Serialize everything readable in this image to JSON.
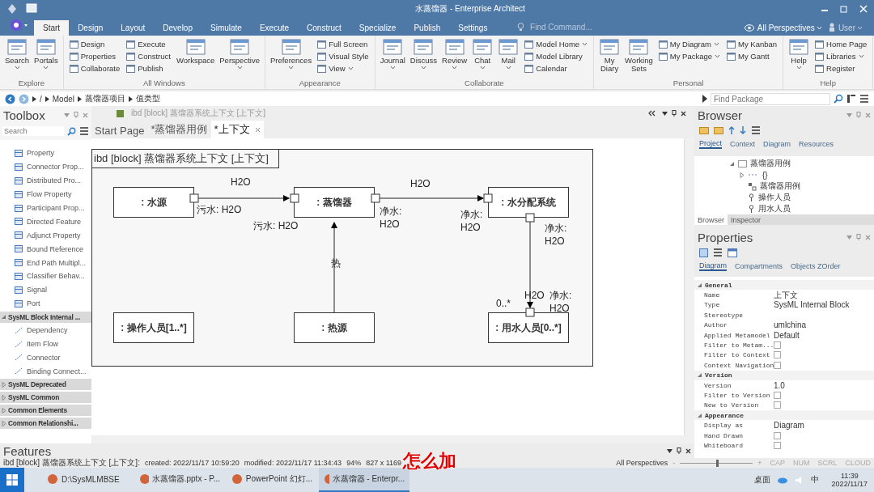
{
  "window": {
    "title": "水蒸馏器 - Enterprise Architect"
  },
  "ribbon_tabs": [
    {
      "label": "Start",
      "selected": true
    },
    {
      "label": "Design",
      "selected": false
    },
    {
      "label": "Layout",
      "selected": false
    },
    {
      "label": "Develop",
      "selected": false
    },
    {
      "label": "Simulate",
      "selected": false
    },
    {
      "label": "Execute",
      "selected": false
    },
    {
      "label": "Construct",
      "selected": false
    },
    {
      "label": "Specialize",
      "selected": false
    },
    {
      "label": "Publish",
      "selected": false
    },
    {
      "label": "Settings",
      "selected": false
    }
  ],
  "find_command": {
    "placeholder": "Find Command..."
  },
  "perspective": "All Perspectives",
  "user": "User",
  "ribbon_groups": [
    {
      "label": "Explore",
      "blocks": [
        {
          "kind": "large",
          "items": [
            {
              "label": "Search",
              "menu": true
            }
          ]
        },
        {
          "kind": "large",
          "items": [
            {
              "label": "Portals",
              "menu": true
            }
          ]
        }
      ]
    },
    {
      "label": "All Windows",
      "blocks": [
        {
          "kind": "column",
          "items": [
            {
              "label": "Design",
              "menu": false
            },
            {
              "label": "Properties",
              "menu": false
            },
            {
              "label": "Collaborate",
              "menu": false
            }
          ]
        },
        {
          "kind": "column",
          "items": [
            {
              "label": "Execute",
              "menu": false
            },
            {
              "label": "Construct",
              "menu": false
            },
            {
              "label": "Publish",
              "menu": false
            }
          ]
        },
        {
          "kind": "large",
          "items": [
            {
              "label": "Workspace",
              "menu": false
            }
          ]
        },
        {
          "kind": "large",
          "items": [
            {
              "label": "Perspective",
              "menu": true
            }
          ]
        }
      ]
    },
    {
      "label": "Appearance",
      "blocks": [
        {
          "kind": "large",
          "items": [
            {
              "label": "Preferences",
              "menu": true
            }
          ]
        },
        {
          "kind": "column",
          "items": [
            {
              "label": "Full Screen",
              "menu": false
            },
            {
              "label": "Visual Style",
              "menu": false
            },
            {
              "label": "View",
              "menu": true
            }
          ]
        }
      ]
    },
    {
      "label": "Collaborate",
      "blocks": [
        {
          "kind": "large",
          "items": [
            {
              "label": "Journal",
              "menu": true
            }
          ]
        },
        {
          "kind": "large",
          "items": [
            {
              "label": "Discuss",
              "menu": true
            }
          ]
        },
        {
          "kind": "large",
          "items": [
            {
              "label": "Review",
              "menu": true
            }
          ]
        },
        {
          "kind": "large",
          "items": [
            {
              "label": "Chat",
              "menu": true
            }
          ]
        },
        {
          "kind": "large",
          "items": [
            {
              "label": "Mail",
              "menu": true
            }
          ]
        },
        {
          "kind": "column",
          "items": [
            {
              "label": "Model Home",
              "menu": true
            },
            {
              "label": "Model Library",
              "menu": false
            },
            {
              "label": "Calendar",
              "menu": false
            }
          ]
        }
      ]
    },
    {
      "label": "Personal",
      "blocks": [
        {
          "kind": "large",
          "items": [
            {
              "label": "My Diary",
              "menu": false
            }
          ]
        },
        {
          "kind": "large",
          "items": [
            {
              "label": "Working Sets",
              "menu": false
            }
          ]
        },
        {
          "kind": "column",
          "items": [
            {
              "label": "My Diagram",
              "menu": true
            },
            {
              "label": "My Package",
              "menu": true
            }
          ]
        },
        {
          "kind": "column",
          "items": [
            {
              "label": "My Kanban",
              "menu": false
            },
            {
              "label": "My Gantt",
              "menu": false
            }
          ]
        }
      ]
    },
    {
      "label": "Help",
      "blocks": [
        {
          "kind": "large",
          "items": [
            {
              "label": "Help",
              "menu": true
            }
          ]
        },
        {
          "kind": "column",
          "items": [
            {
              "label": "Home Page",
              "menu": false
            },
            {
              "label": "Libraries",
              "menu": true
            },
            {
              "label": "Register",
              "menu": false
            }
          ]
        }
      ]
    }
  ],
  "breadcrumb": [
    "/",
    "Model",
    "蒸馏器项目",
    "值类型"
  ],
  "find_package": {
    "placeholder": "Find Package"
  },
  "toolbox": {
    "title": "Toolbox",
    "search": {
      "placeholder": "Search"
    },
    "items": [
      "Property",
      "Connector Prop...",
      "Distributed Pro...",
      "Flow Property",
      "Participant Prop...",
      "Directed Feature",
      "Adjunct Property",
      "Bound Reference",
      "End Path Multipl...",
      "Classifier Behav...",
      "Signal",
      "Port"
    ],
    "sections": [
      {
        "title": "SysML Block Internal ...",
        "expanded": true,
        "items": [
          "Dependency",
          "Item Flow",
          "Connector",
          "Binding Connect..."
        ]
      },
      {
        "title": "SysML Deprecated",
        "expanded": false
      },
      {
        "title": "SysML Common",
        "expanded": false
      },
      {
        "title": "Common Elements",
        "expanded": false
      },
      {
        "title": "Common Relationshi...",
        "expanded": false
      }
    ]
  },
  "document": {
    "caption": "ibd [block] 蒸馏器系统上下文 [上下文]",
    "tabs": [
      {
        "label": "Start Page",
        "selected": false
      },
      {
        "label": "*蒸馏器用例",
        "selected": false
      },
      {
        "label": "*上下文",
        "selected": true
      }
    ]
  },
  "diagram": {
    "frame_title": "ibd [block] 蒸馏器系统上下文 [上下文]",
    "nodes": [
      ": 水源",
      ": 蒸馏器",
      ": 水分配系统",
      ": 操作人员[1..*]",
      ": 热源",
      ": 用水人员[0..*]"
    ],
    "connectors": [
      {
        "label": "H2O"
      },
      {
        "label": "H2O"
      },
      {
        "label": "热"
      },
      {
        "label": "H2O"
      }
    ],
    "labels": [
      "污水: H2O",
      "污水: H2O",
      "净水:\nH2O",
      "净水:\nH2O",
      "净水:\nH2O",
      "净水:\nH2O",
      "0..*"
    ]
  },
  "browser": {
    "title": "Browser",
    "tabs": [
      {
        "label": "Project",
        "selected": true
      },
      {
        "label": "Context",
        "selected": false
      },
      {
        "label": "Diagram",
        "selected": false
      },
      {
        "label": "Resources",
        "selected": false
      }
    ],
    "tree": [
      {
        "label": "蒸馏器用例",
        "kind": "folder",
        "expanded": true,
        "children": [
          {
            "label": "{}",
            "kind": "package",
            "expanded": false
          },
          {
            "label": "蒸馏器用例",
            "kind": "diagram"
          },
          {
            "label": "操作人员",
            "kind": "actor"
          },
          {
            "label": "用水人员",
            "kind": "actor"
          }
        ]
      }
    ],
    "bottom_tabs": [
      {
        "label": "Browser",
        "selected": true
      },
      {
        "label": "Inspector",
        "selected": false
      }
    ]
  },
  "properties": {
    "title": "Properties",
    "tabs": [
      {
        "label": "Diagram",
        "selected": true
      },
      {
        "label": "Compartments",
        "selected": false
      },
      {
        "label": "Objects ZOrder",
        "selected": false
      }
    ],
    "sections": [
      {
        "title": "General",
        "rows": [
          {
            "label": "Name",
            "kind": "text",
            "value": "上下文"
          },
          {
            "label": "Type",
            "kind": "text",
            "value": "SysML Internal Block"
          },
          {
            "label": "Stereotype",
            "kind": "text"
          },
          {
            "label": "Author",
            "kind": "text",
            "value": "umlchina"
          },
          {
            "label": "Applied Metamodel",
            "kind": "text",
            "value": "Default"
          },
          {
            "label": "Filter to Metam...",
            "kind": "checkbox",
            "checked": false
          },
          {
            "label": "Filter to Context",
            "kind": "checkbox",
            "checked": false
          },
          {
            "label": "Context Navigation",
            "kind": "checkbox",
            "checked": false
          }
        ]
      },
      {
        "title": "Version",
        "rows": [
          {
            "label": "Version",
            "kind": "text",
            "value": "1.0"
          },
          {
            "label": "Filter to Version",
            "kind": "checkbox",
            "checked": false
          },
          {
            "label": "New to Version",
            "kind": "checkbox",
            "checked": false
          }
        ]
      },
      {
        "title": "Appearance",
        "rows": [
          {
            "label": "Display as",
            "kind": "text",
            "value": "Diagram"
          },
          {
            "label": "Hand Drawn",
            "kind": "checkbox",
            "checked": false
          },
          {
            "label": "Whiteboard",
            "kind": "checkbox",
            "checked": false
          }
        ]
      }
    ]
  },
  "features": {
    "title": "Features"
  },
  "status_bar": {
    "diagram": "ibd [block] 蒸馏器系统上下文 [上下文]:",
    "created": "created: 2022/11/17 10:59:20",
    "modified": "modified: 2022/11/17 11:34:43",
    "zoom": "94%",
    "size": "827 x 1169",
    "perspective": "All Perspectives",
    "zoom_out": "-",
    "zoom_in": "+",
    "level": 0.5,
    "indicators": [
      "CAP",
      "NUM",
      "SCRL",
      "CLOUD"
    ]
  },
  "caption": "怎么加",
  "taskbar": {
    "items": [
      {
        "label": "D:\\SysMLMBSE",
        "selected": false
      },
      {
        "label": "水蒸馏器.pptx - P...",
        "selected": false
      },
      {
        "label": "PowerPoint 幻灯...",
        "selected": false
      },
      {
        "label": "水蒸馏器 - Enterpr...",
        "selected": true
      }
    ],
    "desktop": "桌面",
    "ime": "中",
    "time": "11:39",
    "date": "2022/11/17"
  }
}
